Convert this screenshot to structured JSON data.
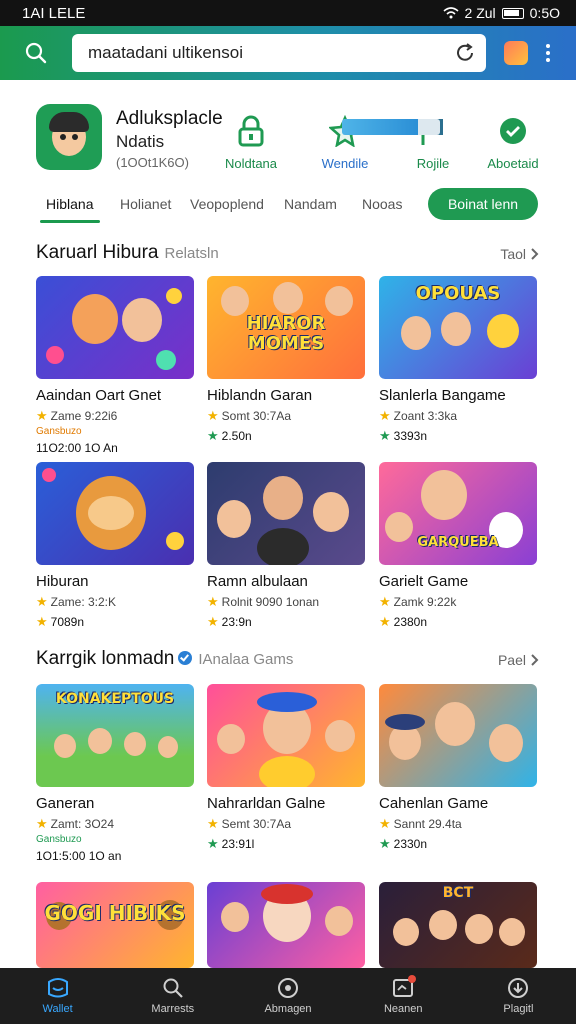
{
  "status_bar": {
    "time": "1AI LELE",
    "right_text": "2 Zul",
    "clock": "0:5O"
  },
  "search": {
    "query": "maatadani ultikensoi"
  },
  "app": {
    "title": "Adluksplacle",
    "subtitle": "Ndatis",
    "meta": "(1OOt1K6O)",
    "actions": [
      {
        "label": "Noldtana",
        "icon": "lock-icon"
      },
      {
        "label": "Wendile",
        "icon": "star-icon"
      },
      {
        "label": "Rojile",
        "icon": "flag-icon"
      },
      {
        "label": "Aboetaid",
        "icon": "check-icon"
      }
    ],
    "progress": 0.78
  },
  "tabs": [
    "Hiblana",
    "Holianet",
    "Veopoplend",
    "Nandam",
    "Nooas"
  ],
  "active_tab": 0,
  "install_label": "Boinat lenn",
  "section1": {
    "title": "Karuarl Hibura",
    "subtitle": "Relatsln",
    "see_all": "Taol",
    "cards": [
      {
        "name": "Aaindan Oart Gnet",
        "rating": "Zame 9:22i6",
        "extra": "11O2:00 1O An",
        "badge": "Gansbuzo",
        "thumb_text": ""
      },
      {
        "name": "Hiblandn Garan",
        "rating": "Somt 30:7Aa",
        "extra": "2.50n",
        "thumb_text": "HIAROR MOMES"
      },
      {
        "name": "Slanlerla Bangame",
        "rating": "Zoant 3:3ka",
        "extra": "3393n",
        "thumb_text": "OPOUAS"
      },
      {
        "name": "Hiburan",
        "rating": "Zame: 3:2:K",
        "extra": "7089n",
        "thumb_text": ""
      },
      {
        "name": "Ramn albulaan",
        "rating": "Rolnit 9090 1onan",
        "extra": "23:9n",
        "thumb_text": ""
      },
      {
        "name": "Garielt Game",
        "rating": "Zamk 9:22k",
        "extra": "2380n",
        "thumb_text": "GARQUEBA"
      }
    ]
  },
  "section2": {
    "title": "Karrgik lonmadn",
    "subtitle": "IAnalaa Gams",
    "see_all": "Pael",
    "cards": [
      {
        "name": "Ganeran",
        "rating": "Zamt: 3O24",
        "extra": "1O1:5:00 1O an",
        "badge": "Gansbuzo",
        "thumb_text": "KONAKEPTOUS"
      },
      {
        "name": "Nahrarldan Galne",
        "rating": "Semt 30:7Aa",
        "extra": "23:91l",
        "thumb_text": ""
      },
      {
        "name": "Cahenlan Game",
        "rating": "Sannt 29.4ta",
        "extra": "2330n",
        "thumb_text": ""
      },
      {
        "name": "",
        "rating": "",
        "extra": "",
        "thumb_text": "GOGI HIBIKS"
      },
      {
        "name": "",
        "rating": "",
        "extra": "",
        "thumb_text": ""
      },
      {
        "name": "",
        "rating": "",
        "extra": "",
        "thumb_text": "BCT"
      }
    ]
  },
  "bottom_nav": [
    {
      "label": "Wallet",
      "icon": "wallet-icon"
    },
    {
      "label": "Marrests",
      "icon": "search-icon"
    },
    {
      "label": "Abmagen",
      "icon": "compass-icon"
    },
    {
      "label": "Neanen",
      "icon": "notifications-icon"
    },
    {
      "label": "Plagitl",
      "icon": "download-icon"
    }
  ],
  "active_nav": 0,
  "colors": {
    "brand_green": "#1f9a52",
    "accent_blue": "#2a7fd4",
    "nav_active": "#39a8ff"
  }
}
